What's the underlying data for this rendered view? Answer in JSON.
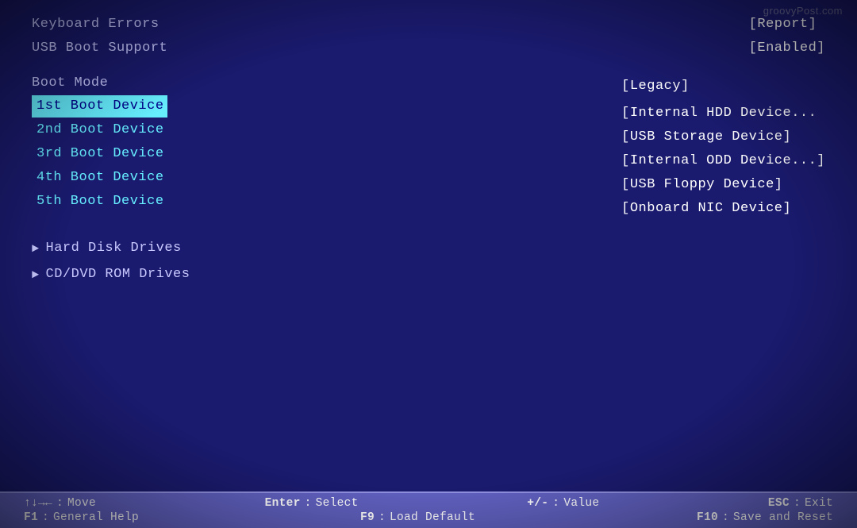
{
  "watermark": "groovyPost.com",
  "top_items": [
    {
      "label": "Keyboard Errors",
      "value": "[Report]"
    },
    {
      "label": "USB Boot Support",
      "value": "[Enabled]"
    }
  ],
  "boot_mode": {
    "label": "Boot Mode",
    "value": "[Legacy]"
  },
  "boot_devices": [
    {
      "label": "1st Boot Device",
      "value": "[Internal HDD Device...",
      "selected": true
    },
    {
      "label": "2nd Boot Device",
      "value": "[USB Storage Device]",
      "selected": false
    },
    {
      "label": "3rd Boot Device",
      "value": "[Internal ODD Device...]",
      "selected": false
    },
    {
      "label": "4th Boot Device",
      "value": "[USB Floppy Device]",
      "selected": false
    },
    {
      "label": "5th Boot Device",
      "value": "[Onboard NIC Device]",
      "selected": false
    }
  ],
  "drives": [
    {
      "label": "Hard Disk Drives"
    },
    {
      "label": "CD/DVD ROM Drives"
    }
  ],
  "hints": {
    "row1": [
      {
        "key": "↑↓→←",
        "sep": ":",
        "desc": "Move"
      },
      {
        "key": "Enter",
        "sep": ":",
        "desc": "Select"
      },
      {
        "key": "+/-",
        "sep": ":",
        "desc": "Value"
      },
      {
        "key": "ESC",
        "sep": ":",
        "desc": "Exit"
      }
    ],
    "row2": [
      {
        "key": "F1",
        "sep": ":",
        "desc": "General Help"
      },
      {
        "key": "F9",
        "sep": ":",
        "desc": "Load Default"
      },
      {
        "key": "F10",
        "sep": ":",
        "desc": "Save and Reset"
      }
    ]
  }
}
